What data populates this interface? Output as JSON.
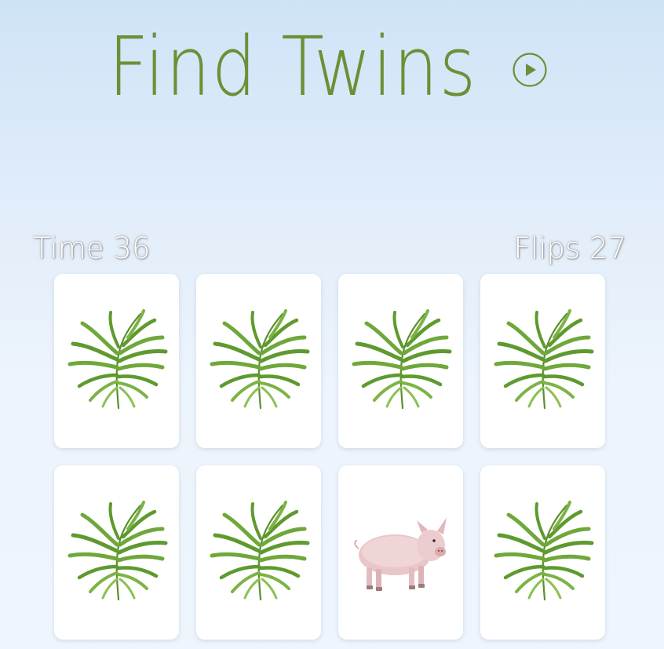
{
  "header": {
    "title": "Find Twins",
    "play_icon": "play-circle-icon",
    "title_color": "#6b9036"
  },
  "stats": {
    "time_label": "Time",
    "time_value": "36",
    "time_text": "Time 36",
    "flips_label": "Flips",
    "flips_value": "27",
    "flips_text": "Flips 27"
  },
  "board": {
    "columns": 4,
    "rows": 2,
    "cards": [
      {
        "state": "face-down",
        "image": "palm-leaf-icon"
      },
      {
        "state": "face-down",
        "image": "palm-leaf-icon"
      },
      {
        "state": "face-down",
        "image": "palm-leaf-icon"
      },
      {
        "state": "face-down",
        "image": "palm-leaf-icon"
      },
      {
        "state": "face-down",
        "image": "palm-leaf-icon"
      },
      {
        "state": "face-down",
        "image": "palm-leaf-icon"
      },
      {
        "state": "face-up",
        "image": "pig-icon"
      },
      {
        "state": "face-down",
        "image": "palm-leaf-icon"
      }
    ]
  },
  "colors": {
    "leaf": "#5e9a2e",
    "leaf_light": "#8cc152",
    "pig": "#e9c9cc",
    "background_top": "#cfe3f7",
    "background_bottom": "#eef5fd"
  }
}
